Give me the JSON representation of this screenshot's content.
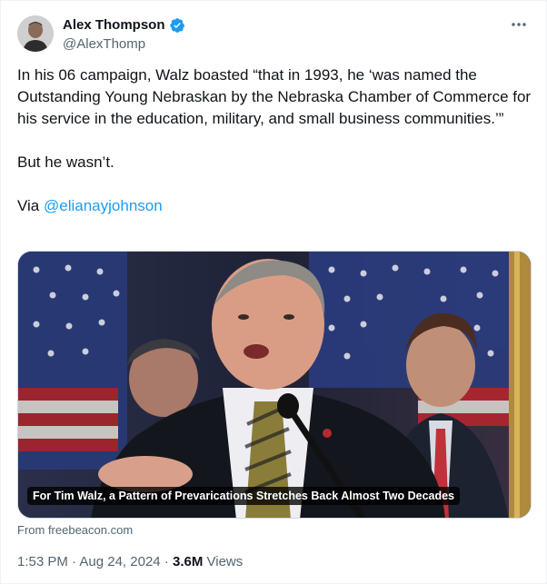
{
  "author": {
    "display_name": "Alex Thompson",
    "handle": "@AlexThomp",
    "verified": true,
    "avatar_icon": "profile-photo"
  },
  "more_menu_icon": "more-horizontal-icon",
  "tweet": {
    "paragraph1": "In his 06 campaign, Walz boasted “that in 1993, he ‘was named the Outstanding Young Nebraskan by the Nebraska Chamber of Commerce for his service in the education, military, and small business communities.’”",
    "paragraph2": "But he wasn’t.",
    "via_prefix": "Via ",
    "via_mention": "@elianayjohnson"
  },
  "card": {
    "image_alt_icon": "news-photo",
    "caption": "For Tim Walz, a Pattern of Prevarications Stretches Back Almost Two Decades",
    "source": "From freebeacon.com"
  },
  "meta": {
    "time": "1:53 PM",
    "separator": " · ",
    "date": "Aug 24, 2024",
    "views_count": "3.6M",
    "views_label": " Views"
  },
  "colors": {
    "link": "#1d9bf0",
    "verified_badge": "#1d9bf0",
    "secondary_text": "#536471",
    "primary_text": "#0f1419"
  }
}
